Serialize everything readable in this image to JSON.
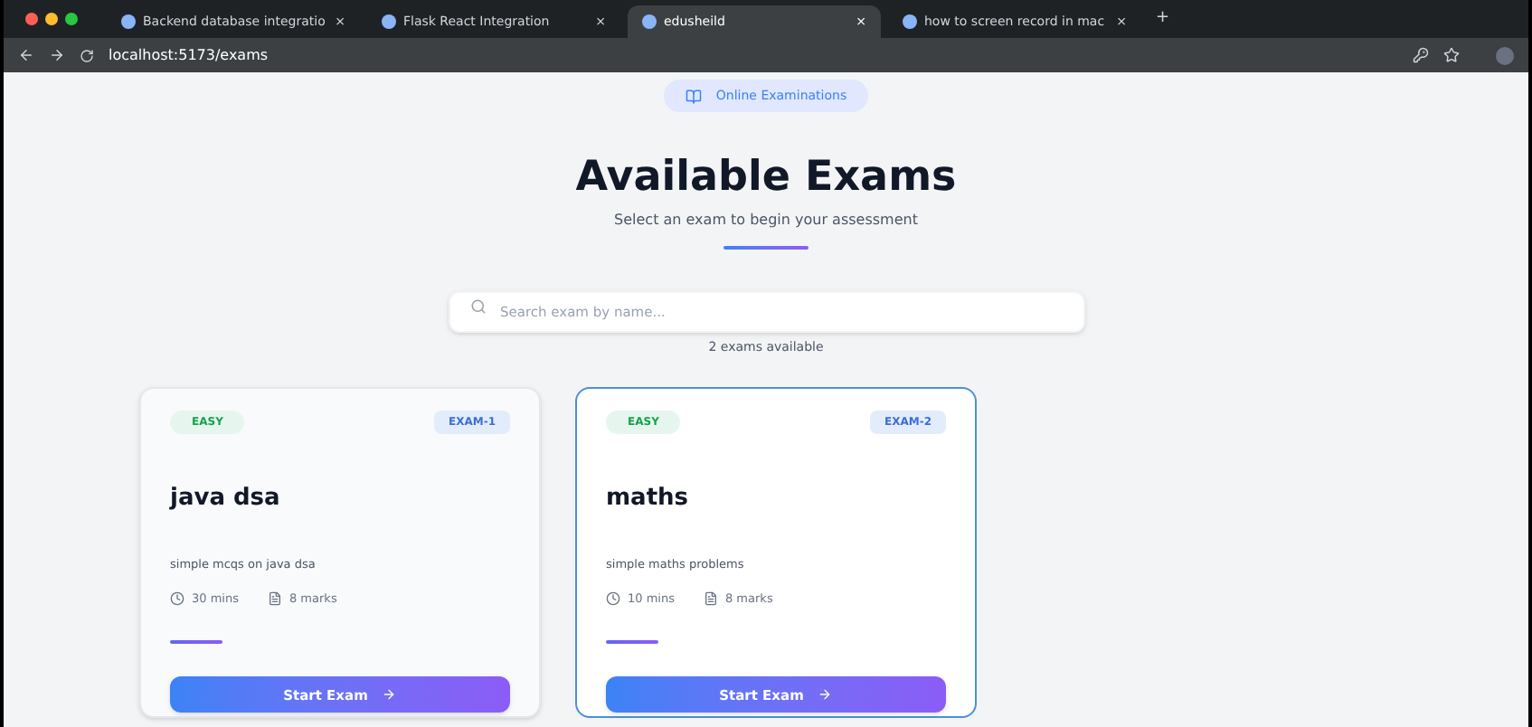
{
  "browser": {
    "tabs": [
      {
        "title": "Backend database integratio",
        "selected": false,
        "close": "×"
      },
      {
        "title": "Flask React Integration",
        "selected": false,
        "close": "×"
      },
      {
        "title": "edusheild",
        "selected": true,
        "close": "×"
      },
      {
        "title": "how to screen record in mac",
        "selected": false,
        "close": "×"
      }
    ],
    "new_tab": "+",
    "url": "localhost:5173/exams"
  },
  "badge": "Online Examinations",
  "title": "Available Exams",
  "subtitle": "Select an exam to begin your assessment",
  "search": {
    "placeholder": "Search exam by name..."
  },
  "count": "2 exams available",
  "exams": [
    {
      "difficulty": "EASY",
      "code": "EXAM-1",
      "name": "java dsa",
      "description": "simple mcqs on java dsa",
      "duration": "30 mins",
      "marks": "8 marks",
      "button": "Start Exam",
      "selected": false
    },
    {
      "difficulty": "EASY",
      "code": "EXAM-2",
      "name": "maths",
      "description": "simple maths problems",
      "duration": "10 mins",
      "marks": "8 marks",
      "button": "Start Exam",
      "selected": true
    }
  ]
}
